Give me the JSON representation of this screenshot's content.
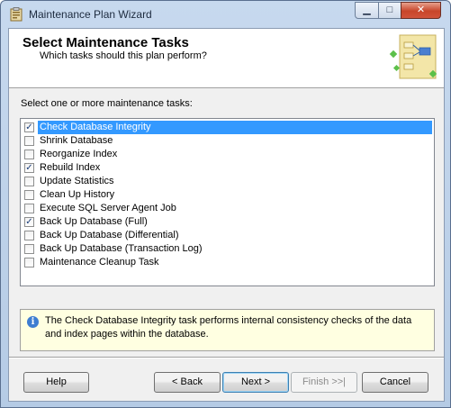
{
  "window": {
    "title": "Maintenance Plan Wizard",
    "minimize_glyph": "▁",
    "maximize_glyph": "□",
    "close_glyph": "✕"
  },
  "header": {
    "title": "Select Maintenance Tasks",
    "subtitle": "Which tasks should this plan perform?"
  },
  "prompt": "Select one or more maintenance tasks:",
  "tasks": [
    {
      "label": "Check Database Integrity",
      "checked": true,
      "selected": true
    },
    {
      "label": "Shrink Database",
      "checked": false,
      "selected": false
    },
    {
      "label": "Reorganize Index",
      "checked": false,
      "selected": false
    },
    {
      "label": "Rebuild Index",
      "checked": true,
      "selected": false
    },
    {
      "label": "Update Statistics",
      "checked": false,
      "selected": false
    },
    {
      "label": "Clean Up History",
      "checked": false,
      "selected": false
    },
    {
      "label": "Execute SQL Server Agent Job",
      "checked": false,
      "selected": false
    },
    {
      "label": "Back Up Database (Full)",
      "checked": true,
      "selected": false
    },
    {
      "label": "Back Up Database (Differential)",
      "checked": false,
      "selected": false
    },
    {
      "label": "Back Up Database (Transaction Log)",
      "checked": false,
      "selected": false
    },
    {
      "label": "Maintenance Cleanup Task",
      "checked": false,
      "selected": false
    }
  ],
  "info": {
    "icon": "info-icon",
    "icon_glyph": "i",
    "text": "The Check Database Integrity task performs internal consistency checks of the data and index pages within the database."
  },
  "buttons": {
    "help": "Help",
    "back": "< Back",
    "next": "Next >",
    "finish": "Finish >>|",
    "cancel": "Cancel"
  },
  "colors": {
    "selection": "#3399ff",
    "info_background": "#ffffe1",
    "close_button": "#c8452a"
  }
}
